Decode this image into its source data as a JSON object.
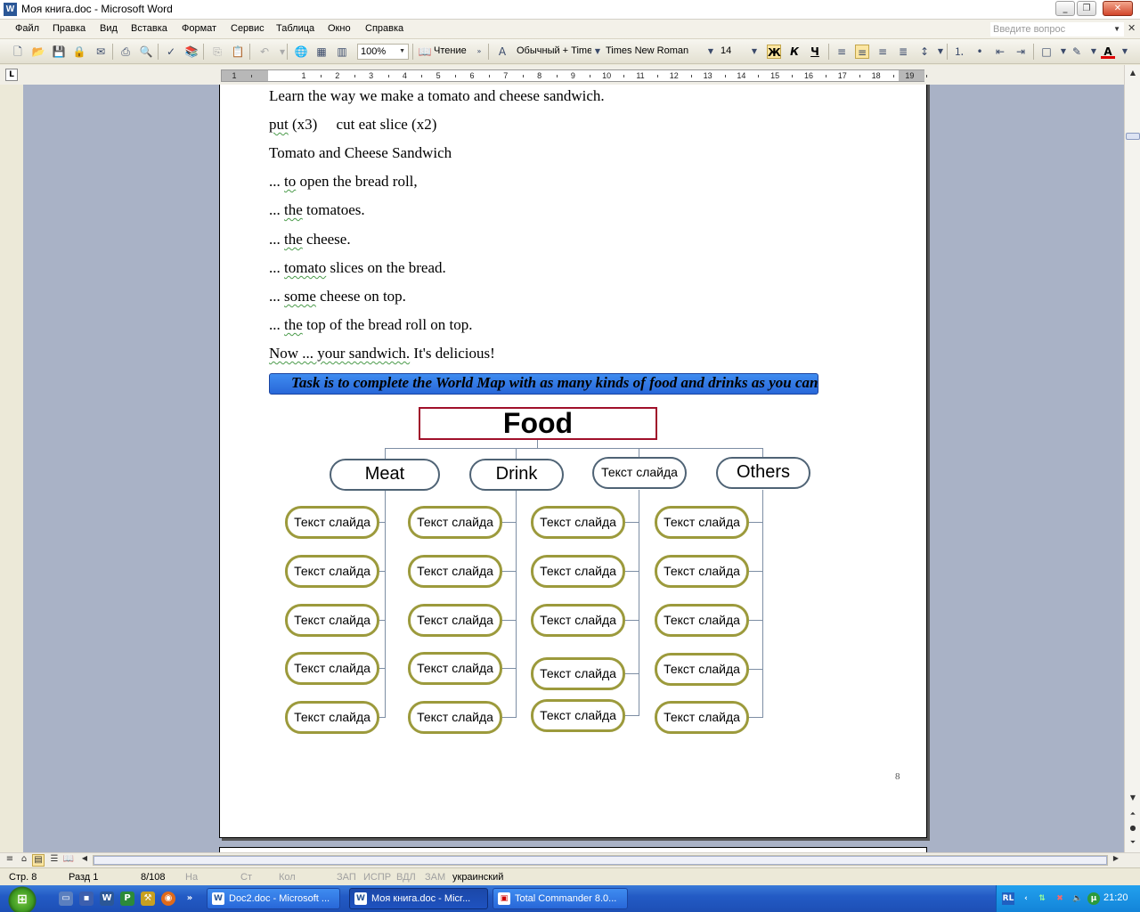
{
  "window": {
    "title": "Моя книга.doc - Microsoft Word",
    "app_icon": "W"
  },
  "menu": {
    "items": [
      "Файл",
      "Правка",
      "Вид",
      "Вставка",
      "Формат",
      "Сервис",
      "Таблица",
      "Окно",
      "Справка"
    ],
    "ask_placeholder": "Введите вопрос"
  },
  "toolbar": {
    "zoom": "100%",
    "reading": "Чтение",
    "style": "Обычный + Time",
    "font": "Times New Roman",
    "size": "14",
    "bold": "Ж",
    "italic": "К",
    "underline": "Ч"
  },
  "ruler": {
    "numbers": [
      "1",
      "1",
      "2",
      "3",
      "4",
      "5",
      "6",
      "7",
      "8",
      "9",
      "10",
      "11",
      "12",
      "13",
      "14",
      "15",
      "16",
      "17",
      "18",
      "19"
    ]
  },
  "document": {
    "lines": [
      "Learn the way we make a tomato and cheese sandwich.",
      "put (x3)     cut eat slice (x2)",
      "Tomato and Cheese Sandwich",
      "... to open the bread roll,",
      "... the tomatoes.",
      "... the cheese.",
      "... tomato slices on the bread.",
      "... some cheese on top.",
      "... the top of the bread roll on top.",
      "Now ... your sandwich. It's delicious!"
    ],
    "task": "Task is to complete the World Map with as many kinds of food and drinks as you can",
    "page_number": "8"
  },
  "diagram": {
    "root": "Food",
    "categories": [
      "Meat",
      "Drink",
      "Текст слайда",
      "Others"
    ],
    "leaf_text": "Текст слайда"
  },
  "status": {
    "page": "Стр. 8",
    "section": "Разд 1",
    "pages": "8/108",
    "at": "На",
    "line": "Ст",
    "col": "Кол",
    "rec": "ЗАП",
    "trk": "ИСПР",
    "ext": "ВДЛ",
    "ovr": "ЗАМ",
    "lang": "украинский"
  },
  "taskbar": {
    "tasks": [
      "Doc2.doc - Microsoft ...",
      "Моя книга.doc - Micr...",
      "Total Commander 8.0..."
    ],
    "tray_lang": "RL",
    "clock": "21:20"
  },
  "colors": {
    "root_border": "#a0102a",
    "category_border": "#4f6375",
    "leaf_border": "#9c9a3c",
    "connector": "#7d8ea4",
    "workspace": "#a9b2c6"
  }
}
